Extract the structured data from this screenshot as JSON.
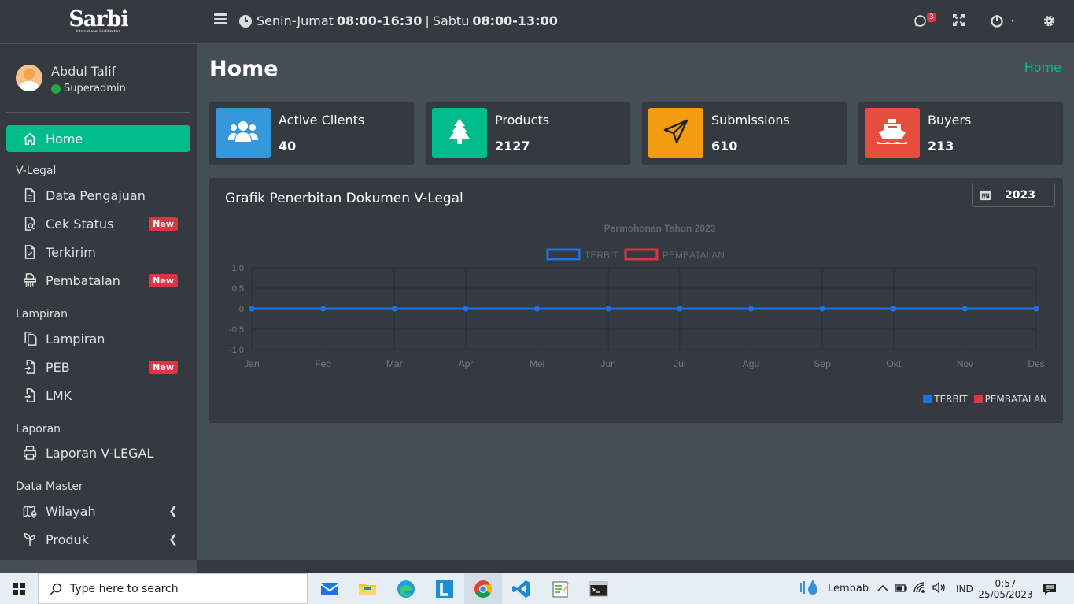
{
  "brand": {
    "logo": "Sarbi",
    "sub": "International Certification"
  },
  "topbar": {
    "hours_day1": "Senin-Jumat",
    "hours_time1": "08:00-16:30",
    "separator": "|",
    "hours_day2": "Sabtu",
    "hours_time2": "08:00-13:00",
    "whatsapp_badge": "3"
  },
  "user": {
    "name": "Abdul Talif",
    "role": "Superadmin"
  },
  "sidebar": {
    "home": "Home",
    "section_vlegal": "V-Legal",
    "data_pengajuan": "Data Pengajuan",
    "cek_status": "Cek Status",
    "terkirim": "Terkirim",
    "pembatalan": "Pembatalan",
    "section_lampiran": "Lampiran",
    "lampiran": "Lampiran",
    "peb": "PEB",
    "lmk": "LMK",
    "section_laporan": "Laporan",
    "laporan_vlegal": "Laporan V-LEGAL",
    "section_master": "Data Master",
    "wilayah": "Wilayah",
    "produk": "Produk",
    "new_badge": "New"
  },
  "page": {
    "title": "Home",
    "breadcrumb": "Home"
  },
  "stats": [
    {
      "label": "Active Clients",
      "value": "40",
      "color": "#3498db"
    },
    {
      "label": "Products",
      "value": "2127",
      "color": "#00bc8c"
    },
    {
      "label": "Submissions",
      "value": "610",
      "color": "#f39c12"
    },
    {
      "label": "Buyers",
      "value": "213",
      "color": "#e74c3c"
    }
  ],
  "chart_panel": {
    "title": "Grafik Penerbitan Dokumen V-Legal",
    "year": "2023"
  },
  "chart_data": {
    "type": "line",
    "title": "Permohonan Tahun 2023",
    "categories": [
      "Jan",
      "Feb",
      "Mar",
      "Apr",
      "Mei",
      "Jun",
      "Jul",
      "Agu",
      "Sep",
      "Okt",
      "Nov",
      "Des"
    ],
    "series": [
      {
        "name": "TERBIT",
        "color": "#1a73e8",
        "values": [
          0,
          0,
          0,
          0,
          0,
          0,
          0,
          0,
          0,
          0,
          0,
          0
        ]
      },
      {
        "name": "PEMBATALAN",
        "color": "#dc3545",
        "values": [
          0,
          0,
          0,
          0,
          0,
          0,
          0,
          0,
          0,
          0,
          0,
          0
        ]
      }
    ],
    "yticks": [
      "1.0",
      "0.5",
      "0",
      "-0.5",
      "-1.0"
    ],
    "ylim": [
      -1,
      1
    ],
    "grid": true,
    "legend": "top"
  },
  "taskbar": {
    "search_placeholder": "Type here to search",
    "weather": "Lembab",
    "lang": "IND",
    "time": "0:57",
    "date": "25/05/2023"
  }
}
